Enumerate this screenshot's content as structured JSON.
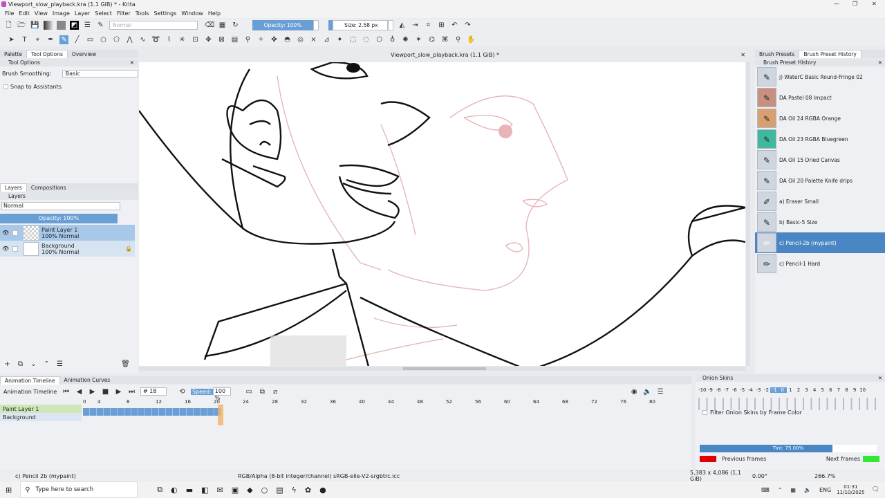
{
  "window": {
    "title": "Viewport_slow_playback.kra (1.1 GiB) * - Krita",
    "min": "—",
    "max": "❐",
    "close": "✕"
  },
  "menu": [
    "File",
    "Edit",
    "View",
    "Image",
    "Layer",
    "Select",
    "Filter",
    "Tools",
    "Settings",
    "Window",
    "Help"
  ],
  "toolbar": {
    "blend_mode": "Normal",
    "opacity": "Opacity: 100%",
    "size": "Size: 2.58 px"
  },
  "left_tabs": [
    "Palette",
    "Tool Options",
    "Overview"
  ],
  "tool_options": {
    "title": "Tool Options",
    "smoothing_label": "Brush Smoothing:",
    "smoothing_value": "Basic",
    "snap_label": "Snap to Assistants"
  },
  "layers_tabs": [
    "Layers",
    "Compositions"
  ],
  "layers": {
    "title": "Layers",
    "blend": "Normal",
    "opacity": "Opacity: 100%",
    "items": [
      {
        "name": "Paint Layer 1",
        "info": "100% Normal"
      },
      {
        "name": "Background",
        "info": "100% Normal"
      }
    ]
  },
  "canvas": {
    "doc_title": "Viewport_slow_playback.kra (1.1 GiB) *"
  },
  "brush_tabs": [
    "Brush Presets",
    "Brush Preset History"
  ],
  "brush_history": {
    "title": "Brush Preset History",
    "items": [
      "j) WaterC Basic Round-Fringe 02",
      "DA Pastel 08 Impact",
      "DA Oil 24 RGBA Orange",
      "DA Oil 23 RGBA Bluegreen",
      "DA Oil 15 Dried Canvas",
      "DA Oil 20 Palette Knife drips",
      "a) Eraser Small",
      "b) Basic-5 Size",
      "c) Pencil-2b (mypaint)",
      "c) Pencil-1 Hard"
    ],
    "selected": 8
  },
  "timeline_tabs": [
    "Animation Timeline",
    "Animation Curves"
  ],
  "timeline": {
    "title": "Animation Timeline",
    "frame": "# 18",
    "speed_label": "Speed:",
    "speed": "100 %",
    "ruler": [
      "0",
      "4",
      "8",
      "12",
      "16",
      "20",
      "24",
      "28",
      "32",
      "36",
      "40",
      "44",
      "48",
      "52",
      "56",
      "60",
      "64",
      "68",
      "72",
      "76",
      "80"
    ],
    "layers": [
      "Paint Layer 1",
      "Background"
    ]
  },
  "onion": {
    "title": "Onion Skins",
    "numbers": [
      "-10",
      "-9",
      "-8",
      "-7",
      "-6",
      "-5",
      "-4",
      "-3",
      "-2",
      "-1",
      "0",
      "1",
      "2",
      "3",
      "4",
      "5",
      "6",
      "7",
      "8",
      "9",
      "10"
    ],
    "filter_label": "Filter Onion Skins by Frame Color",
    "tint": "Tint: 75.00%",
    "prev_label": "Previous frames",
    "next_label": "Next frames",
    "prev_color": "#e00000",
    "next_color": "#33e833"
  },
  "status": {
    "brush": "c) Pencil 2b (mypaint)",
    "color": "RGB/Alpha (8-bit integer/channel)  sRGB-elle-V2-srgbtrc.icc",
    "size": "5,383 x 4,086 (1.1 GiB)",
    "rotation": "0.00°",
    "zoom": "266.7%"
  },
  "taskbar": {
    "search": "Type here to search",
    "lang": "ENG",
    "time": "01:31",
    "date": "11/10/2025"
  }
}
